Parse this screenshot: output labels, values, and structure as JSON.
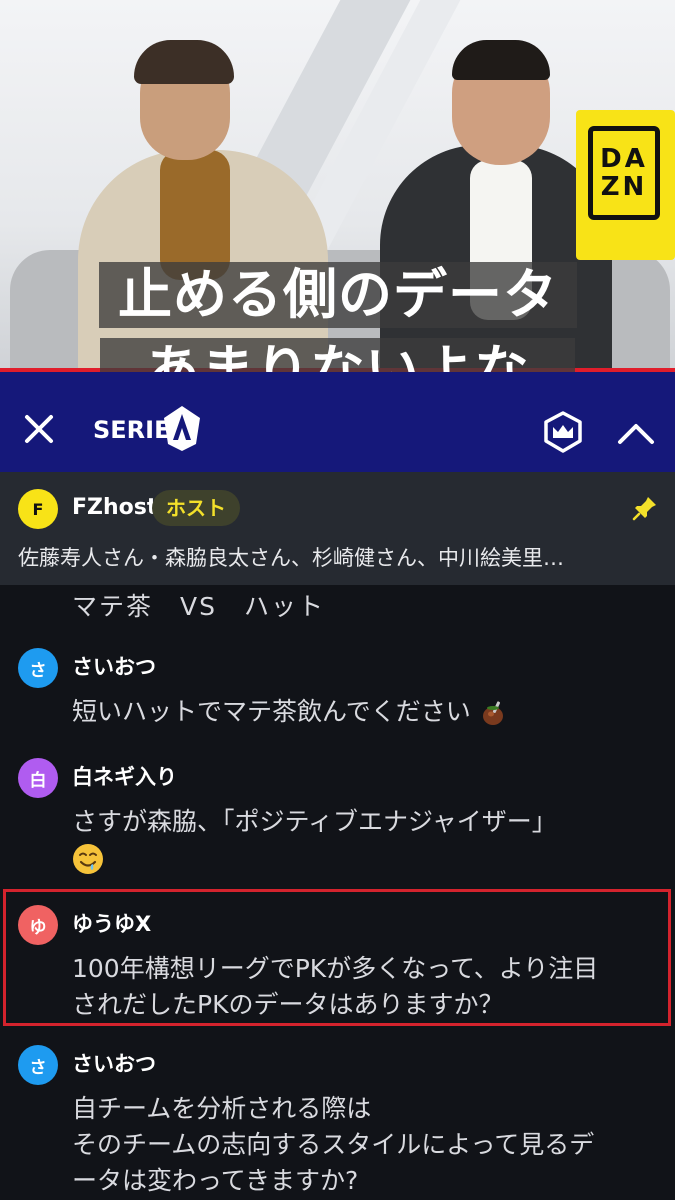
{
  "video": {
    "caption_line1": "止める側のデータ",
    "caption_line2": "あまりないよな",
    "brand_logo_text": "DAZN"
  },
  "header": {
    "league_name": "SERIE",
    "league_color": "#15187a",
    "icons": [
      "close-icon",
      "serie-a-logo-icon",
      "crown-shield-icon",
      "chevron-up-icon"
    ]
  },
  "pinned": {
    "avatar_letter": "F",
    "name": "FZhost",
    "badge": "ホスト",
    "text": "佐藤寿人さん・森脇良太さん、杉崎健さん、中川絵美里…",
    "icon": "pin-icon"
  },
  "chat": {
    "continuation": "マテ茶　VS　ハット",
    "messages": [
      {
        "avatar_letter": "さ",
        "avatar_color": "#1e9bf0",
        "name": "さいおつ",
        "text": "短いハットでマテ茶飲んでください"
      },
      {
        "avatar_letter": "白",
        "avatar_color": "#b05cf0",
        "name": "白ネギ入り",
        "text": "さすが森脇、「ポジティブエナジャイザー」"
      },
      {
        "avatar_letter": "ゆ",
        "avatar_color": "#f06262",
        "name": "ゆうゆX",
        "text_line1": "100年構想リーグでPKが多くなって、より注目",
        "text_line2": "されだしたPKのデータはありますか？"
      },
      {
        "avatar_letter": "さ",
        "avatar_color": "#1e9bf0",
        "name": "さいおつ",
        "text_line1": "自チームを分析される際は",
        "text_line2": "そのチームの志向するスタイルによって見るデ",
        "text_line3": "ータは変わってきますか?"
      }
    ],
    "highlight_color": "#d4232d"
  }
}
